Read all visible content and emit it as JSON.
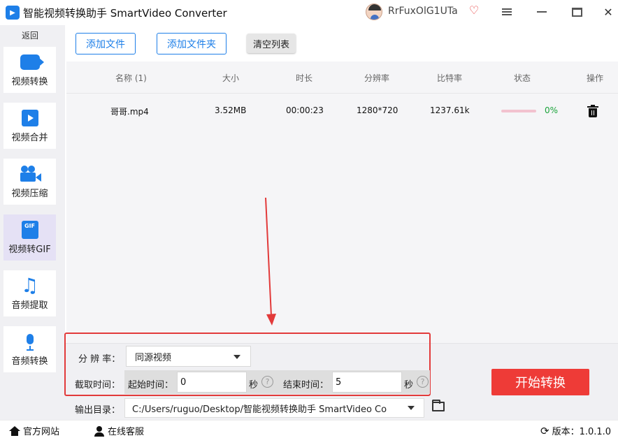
{
  "app": {
    "logo_text": "▶",
    "title": "智能视频转换助手 SmartVideo Converter",
    "username": "RrFuxOlG1UTa"
  },
  "sidebar": {
    "back_label": "返回",
    "items": [
      {
        "label": "视频转换",
        "icon": "video-convert-icon",
        "active": false
      },
      {
        "label": "视频合并",
        "icon": "video-merge-icon",
        "active": false
      },
      {
        "label": "视频压缩",
        "icon": "video-compress-icon",
        "active": false
      },
      {
        "label": "视频转GIF",
        "icon": "gif-icon",
        "active": true
      },
      {
        "label": "音频提取",
        "icon": "music-note-icon",
        "active": false
      },
      {
        "label": "音频转换",
        "icon": "microphone-icon",
        "active": false
      }
    ],
    "gif_icon_text": "GIF"
  },
  "toolbar": {
    "add_file": "添加文件",
    "add_folder": "添加文件夹",
    "clear_list": "清空列表"
  },
  "table": {
    "columns": [
      "名称 (1)",
      "大小",
      "时长",
      "分辨率",
      "比特率",
      "状态",
      "操作"
    ],
    "rows": [
      {
        "name": "哥哥.mp4",
        "size": "3.52MB",
        "duration": "00:00:23",
        "resolution": "1280*720",
        "bitrate": "1237.61k",
        "progress": 0,
        "progress_text": "0%"
      }
    ]
  },
  "settings": {
    "resolution_label": "分 辨 率：",
    "resolution_value": "同源视频",
    "clip_label": "截取时间：",
    "start_label": "起始时间：",
    "start_value": "0",
    "end_label": "结束时间：",
    "end_value": "5",
    "seconds_unit": "秒",
    "help_glyph": "?",
    "output_label": "输出目录：",
    "output_path": "C:/Users/ruguo/Desktop/智能视频转换助手 SmartVideo Co",
    "start_button": "开始转换"
  },
  "footer": {
    "website": "官方网站",
    "support": "在线客服",
    "version": "版本：1.0.1.0"
  },
  "colors": {
    "accent": "#1e7fe8",
    "start_button": "#ee3b37",
    "annotation": "#e23a3a",
    "progress_text": "#1aa33a"
  }
}
